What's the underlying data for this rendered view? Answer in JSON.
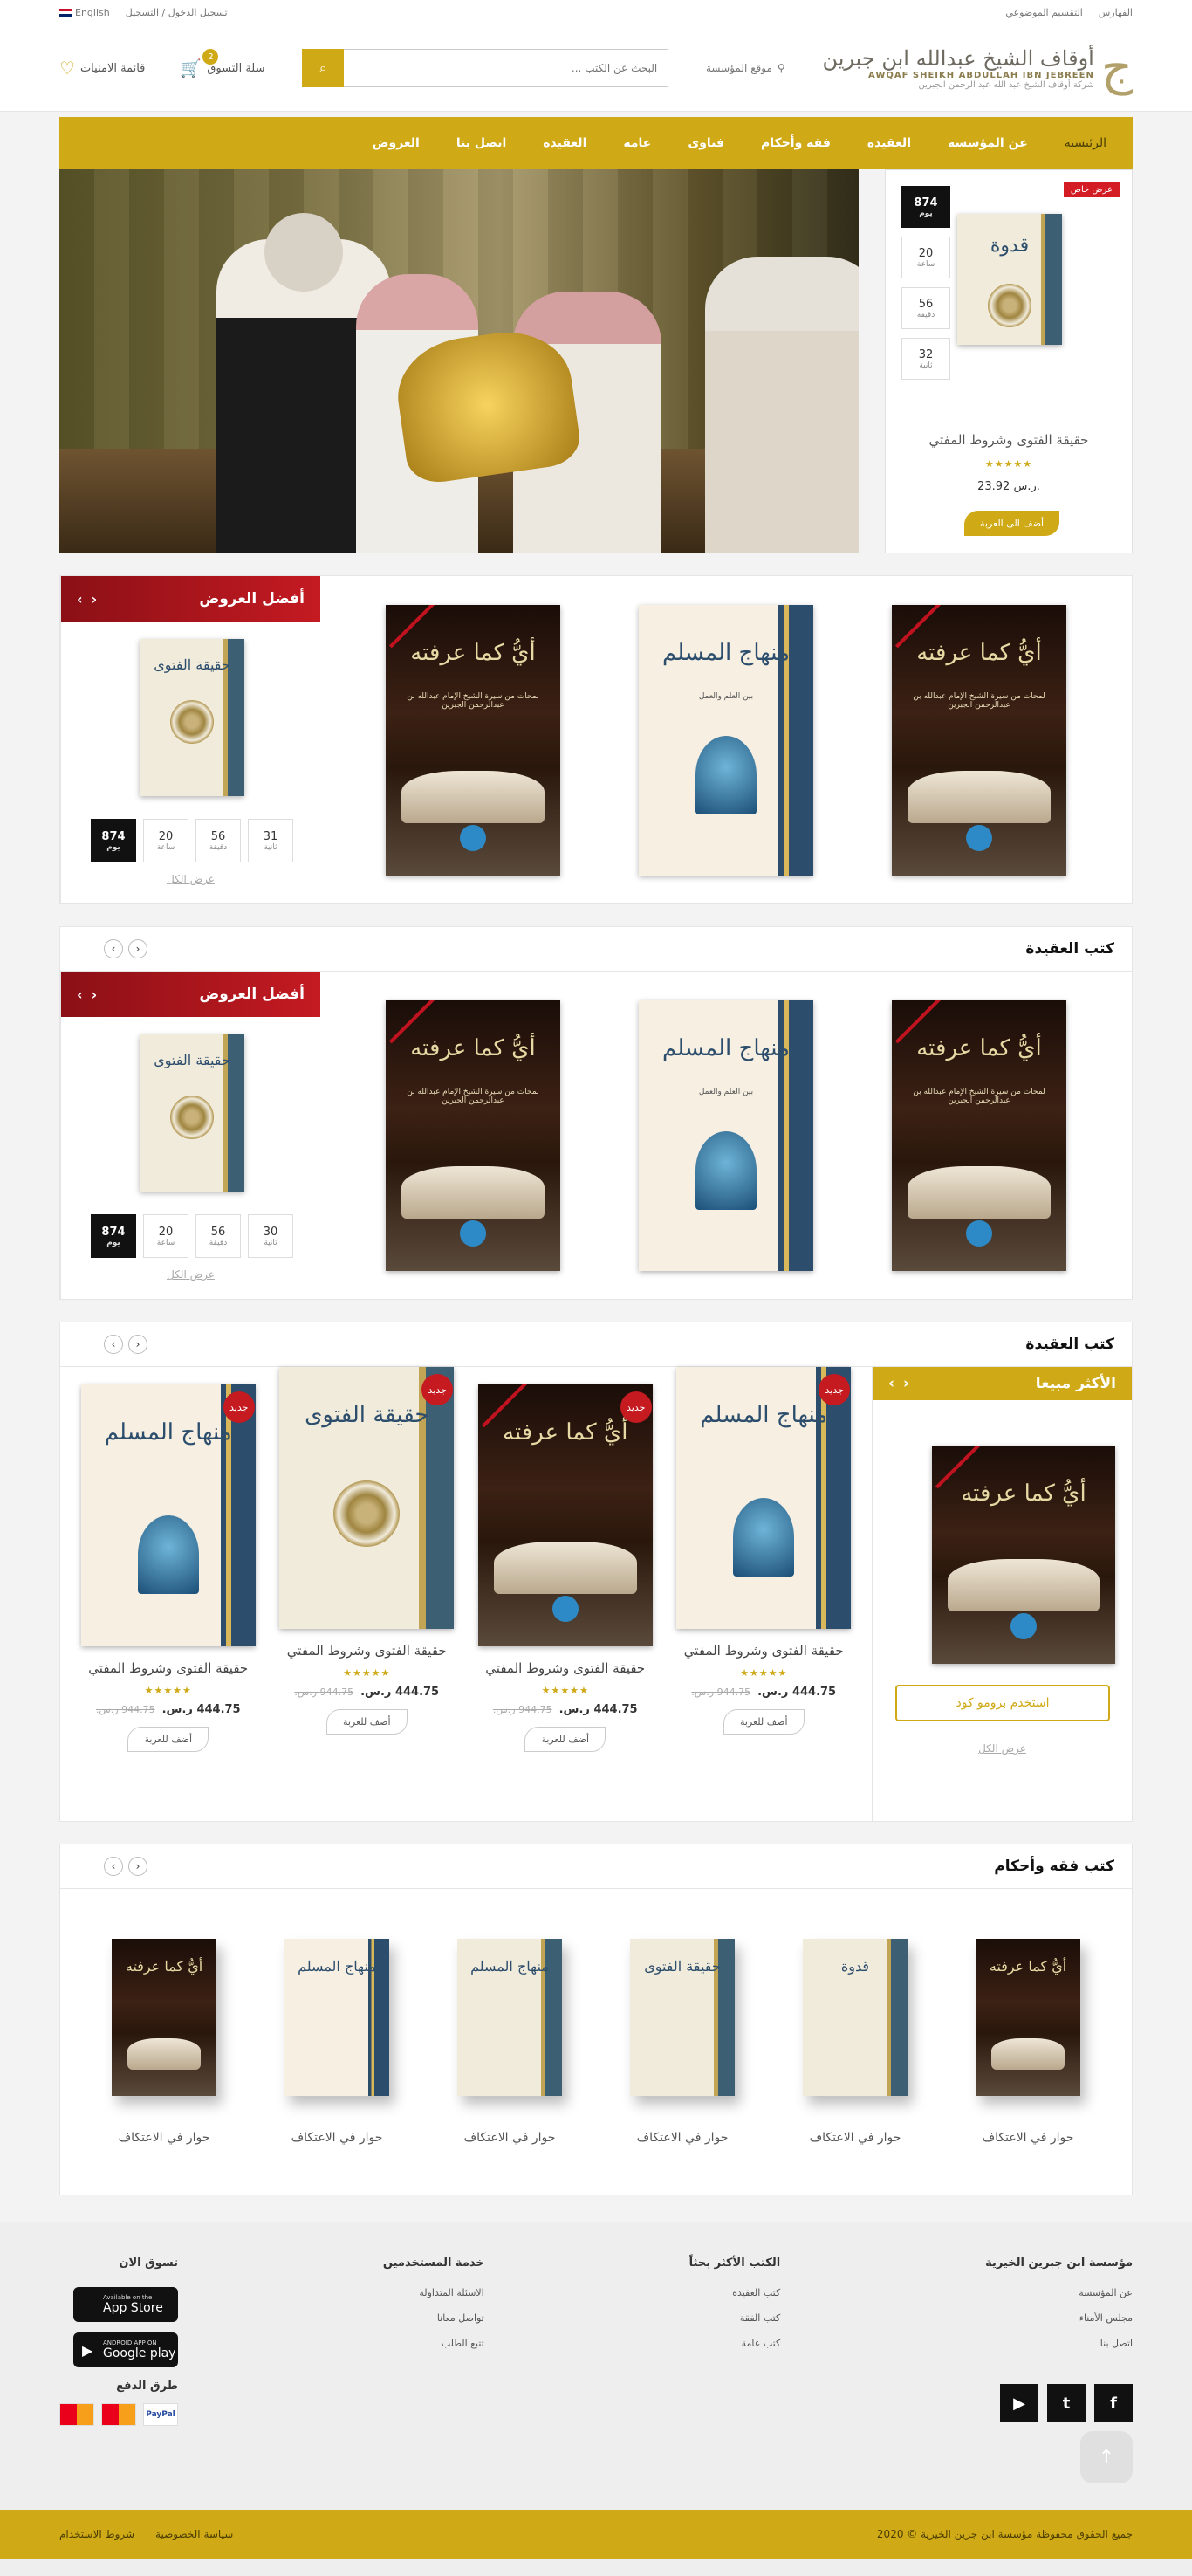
{
  "topbar": {
    "language": "English",
    "auth": "تسجيل الدخول / التسجيل",
    "subject_index": "التقسيم الموضوعي",
    "indexes": "الفهارس"
  },
  "header": {
    "wishlist": "قائمة الامنيات",
    "cart": "سلة التسوق",
    "cart_count": "2",
    "search_placeholder": "البحث عن الكتب ...",
    "location": "موقع المؤسسة",
    "logo_ar": "أوقاف الشيخ عبدالله ابن جبرين",
    "logo_en": "AWQAF SHEIKH ABDULLAH IBN JEBREEN",
    "logo_sub": "شركة أوقاف الشيخ عبد الله عبد الرحمن الجبرين",
    "logo_mark": "ج"
  },
  "nav": [
    {
      "label": "الرئيسية",
      "active": true
    },
    {
      "label": "عن المؤسسة"
    },
    {
      "label": "العقيدة"
    },
    {
      "label": "فقة وأحكام"
    },
    {
      "label": "فتاوى"
    },
    {
      "label": "عامة"
    },
    {
      "label": "العقيدة"
    },
    {
      "label": "اتصل بنا"
    },
    {
      "label": "العروض"
    }
  ],
  "hero_offer": {
    "tag": "عرض خاص",
    "book_title": "قدوة",
    "counters": [
      {
        "value": "874",
        "unit": "يوم"
      },
      {
        "value": "20",
        "unit": "ساعة"
      },
      {
        "value": "56",
        "unit": "دقيقة"
      },
      {
        "value": "32",
        "unit": "ثانية"
      }
    ],
    "title": "حقيقة الفتوى وشروط المفتي",
    "stars": "★★★★★",
    "rating": 4,
    "price": "23.92 ر.س.",
    "add_to_cart": "أضف الى العربة"
  },
  "deal_sections": [
    {
      "books": [
        {
          "title": "أيُّ كما عرفته",
          "sub": "لمحات من سيرة الشيخ الإمام عبدالله بن عبدالرحمن الجبرين",
          "style": "dark"
        },
        {
          "title": "منهاج المسلم",
          "sub": "بين العلم والعمل",
          "style": "light"
        },
        {
          "title": "أيُّ كما عرفته",
          "sub": "لمحات من سيرة الشيخ الإمام عبدالله بن عبدالرحمن الجبرين",
          "style": "dark"
        }
      ],
      "best": {
        "title": "أفضل العروض",
        "book_title": "حقيقة الفتوى",
        "counters": [
          {
            "value": "874",
            "unit": "يوم"
          },
          {
            "value": "20",
            "unit": "ساعة"
          },
          {
            "value": "56",
            "unit": "دقيقة"
          },
          {
            "value": "31",
            "unit": "ثانية"
          }
        ],
        "view_all": "عرض الكل"
      }
    },
    {
      "books": [
        {
          "title": "أيُّ كما عرفته",
          "sub": "لمحات من سيرة الشيخ الإمام عبدالله بن عبدالرحمن الجبرين",
          "style": "dark"
        },
        {
          "title": "منهاج المسلم",
          "sub": "بين العلم والعمل",
          "style": "light"
        },
        {
          "title": "أيُّ كما عرفته",
          "sub": "لمحات من سيرة الشيخ الإمام عبدالله بن عبدالرحمن الجبرين",
          "style": "dark"
        }
      ],
      "best": {
        "title": "أفضل العروض",
        "book_title": "حقيقة الفتوى",
        "counters": [
          {
            "value": "874",
            "unit": "يوم"
          },
          {
            "value": "20",
            "unit": "ساعة"
          },
          {
            "value": "56",
            "unit": "دقيقة"
          },
          {
            "value": "30",
            "unit": "ثانية"
          }
        ],
        "view_all": "عرض الكل"
      }
    }
  ],
  "section_titles": {
    "aqeedah_1": "كتب العقيدة",
    "aqeedah_2": "كتب العقيدة",
    "fiqh": "كتب فقه وأحكام"
  },
  "products_section": {
    "new_label": "جديد",
    "products": [
      {
        "name": "حقيقة الفتوى وشروط المفتي",
        "cover_title": "منهاج المسلم",
        "style": "light",
        "old": "944.75 ر.س.",
        "price": "444.75 ر.س.",
        "stars": "★★★★★",
        "rating": 4,
        "btn": "أضف للعربة"
      },
      {
        "name": "حقيقة الفتوى وشروط المفتي",
        "cover_title": "حقيقة الفتوى",
        "style": "cream",
        "old": "944.75 ر.س.",
        "price": "444.75 ر.س.",
        "stars": "★★★★★",
        "rating": 4,
        "btn": "أضف للعربة"
      },
      {
        "name": "حقيقة الفتوى وشروط المفتي",
        "cover_title": "أيُّ كما عرفته",
        "style": "dark",
        "old": "944.75 ر.س.",
        "price": "444.75 ر.س.",
        "stars": "★★★★★",
        "rating": 4,
        "btn": "أضف للعربة"
      },
      {
        "name": "حقيقة الفتوى وشروط المفتي",
        "cover_title": "منهاج المسلم",
        "style": "light",
        "old": "944.75 ر.س.",
        "price": "444.75 ر.س.",
        "stars": "★★★★★",
        "rating": 4,
        "btn": "أضف للعربة"
      }
    ],
    "top_sellers": {
      "title": "الأكثر مبيعا",
      "book_title": "أيُّ كما عرفته",
      "promo": "استخدم برومو كود",
      "view_all": "عرض الكل"
    }
  },
  "fiqh_items": [
    {
      "name": "حوار في الاعتكاف",
      "cover_title": "أيُّ كما عرفته",
      "style": "dark"
    },
    {
      "name": "حوار في الاعتكاف",
      "cover_title": "منهاج المسلم",
      "style": "light"
    },
    {
      "name": "حوار في الاعتكاف",
      "cover_title": "منهاج المسلم",
      "style": "cream"
    },
    {
      "name": "حوار في الاعتكاف",
      "cover_title": "حقيقة الفتوى",
      "style": "cream"
    },
    {
      "name": "حوار في الاعتكاف",
      "cover_title": "قدوة",
      "style": "cream"
    },
    {
      "name": "حوار في الاعتكاف",
      "cover_title": "أيُّ كما عرفته",
      "style": "dark"
    }
  ],
  "footer": {
    "col1": {
      "title": "مؤسسة ابن جبرين الخيرية",
      "links": [
        "عن المؤسسة",
        "مجلس الأمناء",
        "اتصل بنا"
      ]
    },
    "col2": {
      "title": "الكتب الأكثر بحثاً",
      "links": [
        "كتب العقيدة",
        "كتب الفقة",
        "كتب عامة"
      ]
    },
    "col3": {
      "title": "خدمة المستخدمين",
      "links": [
        "الاسئلة المتداولة",
        "تواصل معانا",
        "تتبع الطلب"
      ]
    },
    "col4": {
      "title": "تسوق الان",
      "appstore_small": "Available on the",
      "appstore": "App Store",
      "gplay_small": "ANDROID APP ON",
      "gplay": "Google play",
      "pay_title": "طرق الدفع",
      "paypal": "PayPal"
    },
    "social": [
      "f",
      "t",
      "▶"
    ],
    "copyright": "جميع الحقوق محفوظة مؤسسة ابن جرين الخيرية © 2020",
    "privacy": "سياسة الخصوصية",
    "terms": "شروط الاستخدام"
  },
  "colors": {
    "gold": "#cfa916",
    "red": "#c51a22",
    "dark": "#111111"
  }
}
